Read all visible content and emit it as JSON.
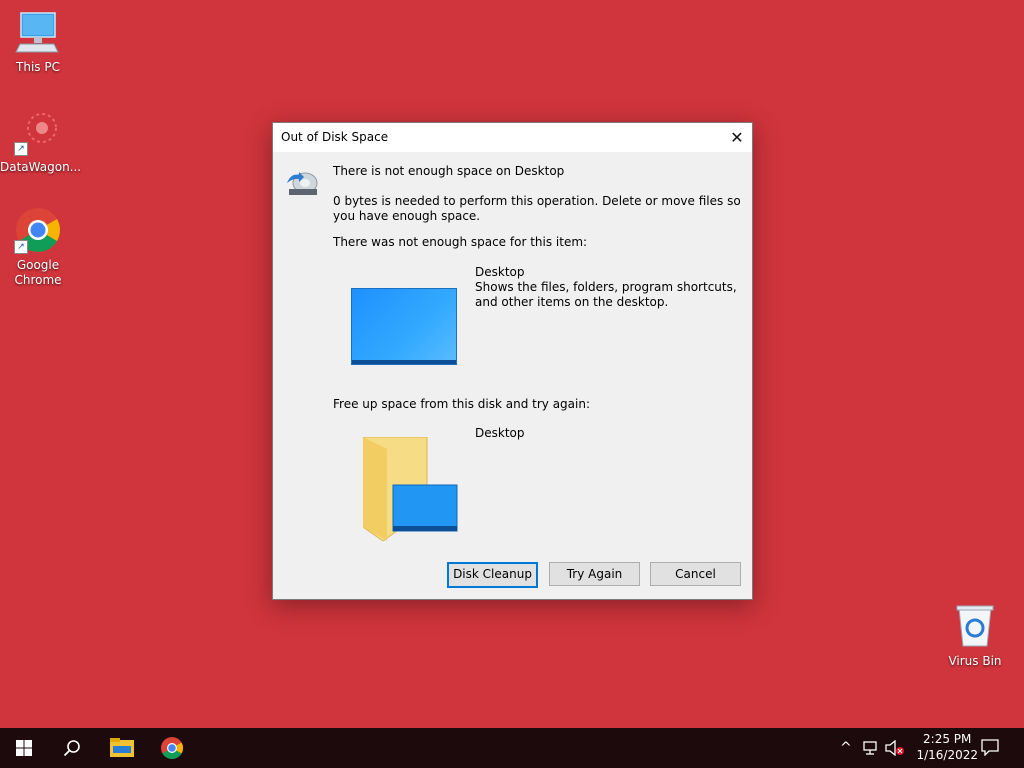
{
  "desktop": {
    "icons": [
      {
        "label": "This PC"
      },
      {
        "label": "DataWagon..."
      },
      {
        "label": "Google Chrome"
      },
      {
        "label": "Virus Bin"
      }
    ]
  },
  "dialog": {
    "title": "Out of Disk Space",
    "close_glyph": "✕",
    "heading": "There is not enough space on Desktop",
    "message": "0 bytes is needed to perform this operation. Delete or move files so you have enough space.",
    "item_label": "There was not enough space for this item:",
    "item_name": "Desktop",
    "item_description": "Shows the files, folders, program shortcuts, and other items on the desktop.",
    "free_label": "Free up space from this disk and try again:",
    "disk_name": "Desktop",
    "buttons": {
      "disk_cleanup": "Disk Cleanup",
      "try_again": "Try Again",
      "cancel": "Cancel"
    }
  },
  "taskbar": {
    "clock_time": "2:25 PM",
    "clock_date": "1/16/2022",
    "tray_chevron": "^"
  },
  "colors": {
    "desktop_bg": "#d0343c",
    "taskbar_bg": "#1d0a0c",
    "accent": "#0078d7"
  }
}
